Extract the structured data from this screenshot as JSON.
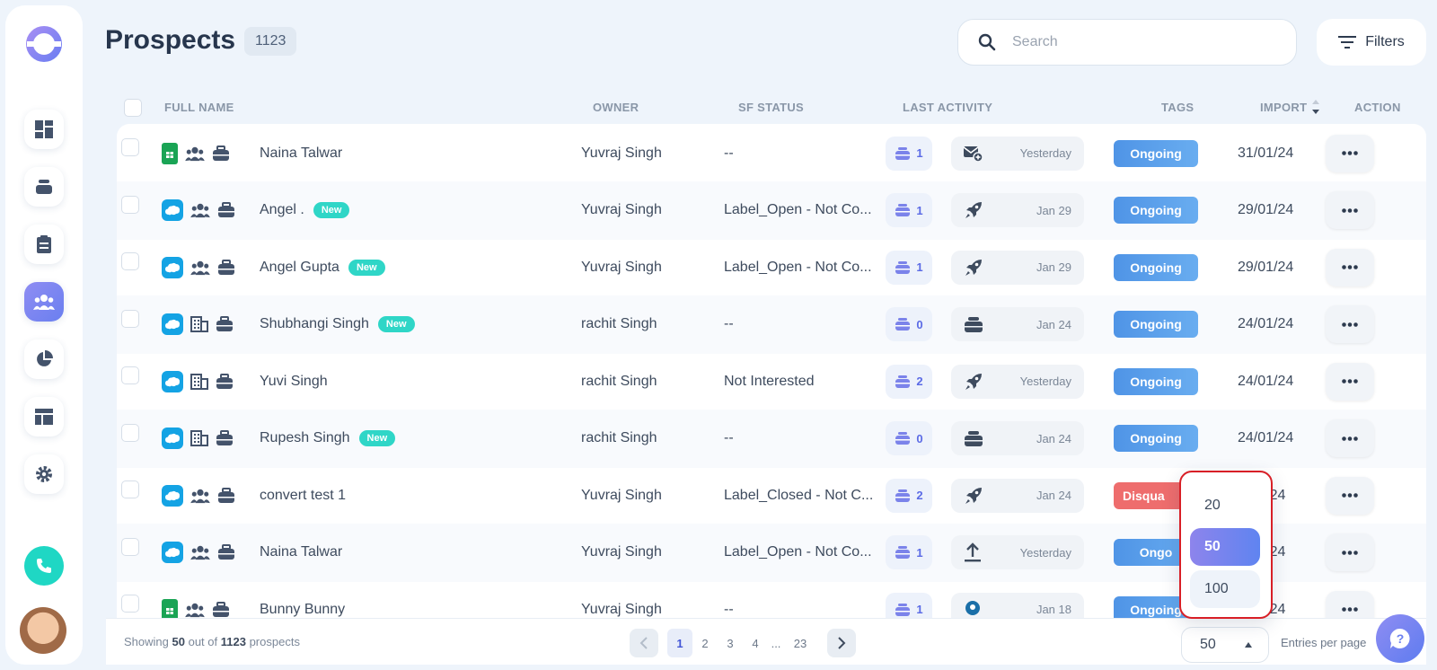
{
  "header": {
    "title": "Prospects",
    "count": "1123",
    "search_placeholder": "Search",
    "filters_label": "Filters"
  },
  "table": {
    "columns": [
      "FULL NAME",
      "OWNER",
      "SF STATUS",
      "LAST ACTIVITY",
      "TAGS",
      "IMPORT",
      "ACTION"
    ],
    "rows": [
      {
        "source": "google-sheets-icon",
        "type": "people-icon",
        "name": "Naina Talwar",
        "new": "",
        "owner": "Yuvraj Singh",
        "status": "--",
        "act_count": "1",
        "act_icon": "mail-add-icon",
        "act_date": "Yesterday",
        "tag": "Ongoing",
        "import": "31/01/24"
      },
      {
        "source": "salesforce-icon",
        "type": "people-icon",
        "name": "Angel .",
        "new": "New",
        "owner": "Yuvraj Singh",
        "status": "Label_Open - Not Co...",
        "act_count": "1",
        "act_icon": "rocket-icon",
        "act_date": "Jan 29",
        "tag": "Ongoing",
        "import": "29/01/24"
      },
      {
        "source": "salesforce-icon",
        "type": "people-icon",
        "name": "Angel Gupta",
        "new": "New",
        "owner": "Yuvraj Singh",
        "status": "Label_Open - Not Co...",
        "act_count": "1",
        "act_icon": "rocket-icon",
        "act_date": "Jan 29",
        "tag": "Ongoing",
        "import": "29/01/24"
      },
      {
        "source": "salesforce-icon",
        "type": "building-icon",
        "name": "Shubhangi Singh",
        "new": "New",
        "owner": "rachit Singh",
        "status": "--",
        "act_count": "0",
        "act_icon": "stack-icon",
        "act_date": "Jan 24",
        "tag": "Ongoing",
        "import": "24/01/24"
      },
      {
        "source": "salesforce-icon",
        "type": "building-icon",
        "name": "Yuvi Singh",
        "new": "",
        "owner": "rachit Singh",
        "status": "Not Interested",
        "act_count": "2",
        "act_icon": "rocket-icon",
        "act_date": "Yesterday",
        "tag": "Ongoing",
        "import": "24/01/24"
      },
      {
        "source": "salesforce-icon",
        "type": "building-icon",
        "name": "Rupesh Singh",
        "new": "New",
        "owner": "rachit Singh",
        "status": "--",
        "act_count": "0",
        "act_icon": "stack-icon",
        "act_date": "Jan 24",
        "tag": "Ongoing",
        "import": "24/01/24"
      },
      {
        "source": "salesforce-icon",
        "type": "people-icon",
        "name": "convert test 1",
        "new": "",
        "owner": "Yuvraj Singh",
        "status": "Label_Closed - Not C...",
        "act_count": "2",
        "act_icon": "rocket-icon",
        "act_date": "Jan 24",
        "tag": "Disqua",
        "import": "4/01/24"
      },
      {
        "source": "salesforce-icon",
        "type": "people-icon",
        "name": "Naina Talwar",
        "new": "",
        "owner": "Yuvraj Singh",
        "status": "Label_Open - Not Co...",
        "act_count": "1",
        "act_icon": "upload-icon",
        "act_date": "Yesterday",
        "tag": "Ongo",
        "import": "8/01/24"
      },
      {
        "source": "google-sheets-icon",
        "type": "people-icon",
        "name": "Bunny Bunny",
        "new": "",
        "owner": "Yuvraj Singh",
        "status": "--",
        "act_count": "1",
        "act_icon": "location-icon",
        "act_date": "Jan 18",
        "tag": "Ongoing",
        "import": "8/01/24"
      }
    ]
  },
  "footer": {
    "showing_prefix": "Showing",
    "showing_count": "50",
    "showing_mid": "out of",
    "showing_total": "1123",
    "showing_suffix": "prospects",
    "pages": [
      "1",
      "2",
      "3",
      "4"
    ],
    "ellipsis": "...",
    "last_page": "23",
    "entries_value": "50",
    "entries_label": "Entries per page"
  },
  "dropdown": {
    "options": [
      "20",
      "50",
      "100"
    ],
    "selected": "50"
  }
}
